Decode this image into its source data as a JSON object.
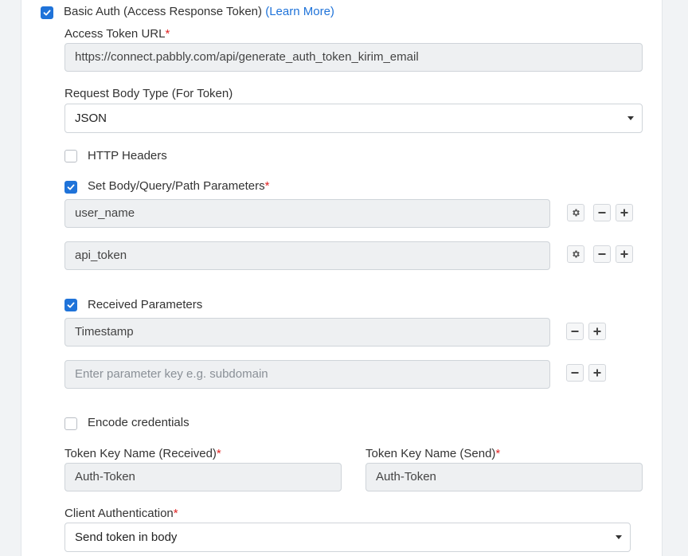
{
  "basic_auth": {
    "checked": true,
    "label": "Basic Auth (Access Response Token)",
    "learn_more": "(Learn More)"
  },
  "access_token_url": {
    "label": "Access Token URL",
    "required": "*",
    "value": "https://connect.pabbly.com/api/generate_auth_token_kirim_email"
  },
  "request_body_type": {
    "label": "Request Body Type (For Token)",
    "value": "JSON"
  },
  "http_headers": {
    "checked": false,
    "label": "HTTP Headers"
  },
  "body_params": {
    "checked": true,
    "label": "Set Body/Query/Path Parameters",
    "required": "*",
    "rows": [
      {
        "value": "user_name"
      },
      {
        "value": "api_token"
      }
    ]
  },
  "received_params": {
    "checked": true,
    "label": "Received Parameters",
    "rows": [
      {
        "value": "Timestamp",
        "placeholder": ""
      },
      {
        "value": "",
        "placeholder": "Enter parameter key e.g. subdomain"
      }
    ]
  },
  "encode_credentials": {
    "checked": false,
    "label": "Encode credentials"
  },
  "token_key_received": {
    "label": "Token Key Name (Received)",
    "required": "*",
    "value": "Auth-Token"
  },
  "token_key_send": {
    "label": "Token Key Name (Send)",
    "required": "*",
    "value": "Auth-Token"
  },
  "client_auth": {
    "label": "Client Authentication",
    "required": "*",
    "value": "Send token in body"
  },
  "icons": {
    "check": "check-icon",
    "settings": "gear-icon",
    "remove": "minus-icon",
    "add": "plus-icon",
    "dropdown": "caret-down-icon"
  },
  "colors": {
    "accent": "#1f73d9",
    "required": "#e02424",
    "input_bg": "#eef0f2",
    "border": "#cfd4d9"
  }
}
